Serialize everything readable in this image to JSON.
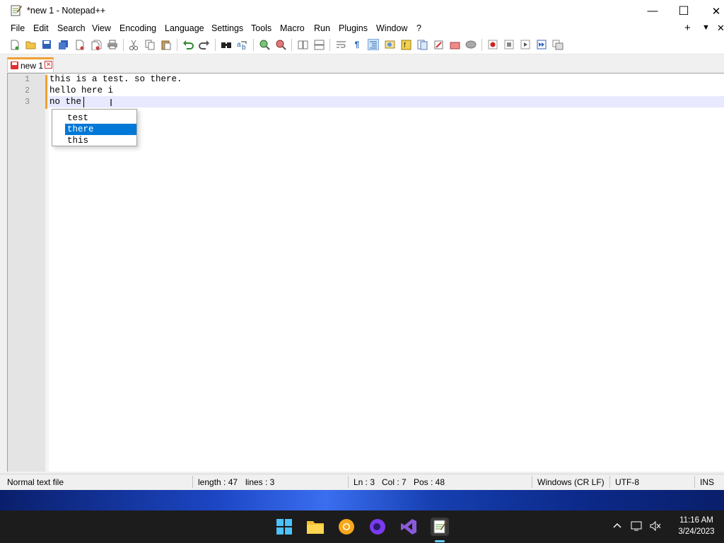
{
  "window": {
    "title": "*new 1 - Notepad++",
    "minimize_glyph": "—",
    "maximize_glyph": "☐",
    "close_glyph": "✕"
  },
  "menu": {
    "items": [
      "File",
      "Edit",
      "Search",
      "View",
      "Encoding",
      "Language",
      "Settings",
      "Tools",
      "Macro",
      "Run",
      "Plugins",
      "Window",
      "?"
    ],
    "plus": "+",
    "down": "▼",
    "close": "✕"
  },
  "toolbar": {
    "icons": [
      "new-file-icon",
      "open-file-icon",
      "save-icon",
      "save-all-icon",
      "close-icon",
      "close-all-icon",
      "print-icon",
      "cut-icon",
      "copy-icon",
      "paste-icon",
      "undo-icon",
      "redo-icon",
      "find-icon",
      "replace-icon",
      "zoom-in-icon",
      "zoom-out-icon",
      "sync-vertical-icon",
      "sync-horizontal-icon",
      "word-wrap-icon",
      "show-all-chars-icon",
      "indent-guide-icon",
      "user-language-icon",
      "function-list-icon",
      "document-map-icon",
      "folder-as-workspace-icon",
      "monitoring-icon",
      "record-macro-icon",
      "stop-record-icon",
      "play-macro-icon",
      "run-macro-multiple-icon",
      "save-macro-icon"
    ]
  },
  "tabs": [
    {
      "label": "new 1",
      "close_glyph": "✕"
    }
  ],
  "editor": {
    "line_numbers": [
      "1",
      "2",
      "3"
    ],
    "lines": [
      "this is a test. so there.",
      "hello here i",
      "no the"
    ],
    "autocomplete": {
      "items": [
        "test",
        "there",
        "this"
      ],
      "selected": "there"
    }
  },
  "status": {
    "file_type": "Normal text file",
    "length": "length : 47",
    "lines": "lines : 3",
    "ln": "Ln : 3",
    "col": "Col : 7",
    "pos": "Pos : 48",
    "eol": "Windows (CR LF)",
    "encoding": "UTF-8",
    "mode": "INS"
  },
  "taskbar": {
    "apps": [
      "windows-start-icon",
      "file-explorer-icon",
      "chrome-canary-icon",
      "firefox-icon",
      "visual-studio-icon",
      "notepad-plus-plus-icon"
    ],
    "time": "11:16 AM",
    "date": "3/24/2023",
    "tray_chevron": "^"
  },
  "colors": {
    "accent_tab": "#f0a030",
    "selection": "#0078d7",
    "current_line": "#e8e8ff"
  }
}
